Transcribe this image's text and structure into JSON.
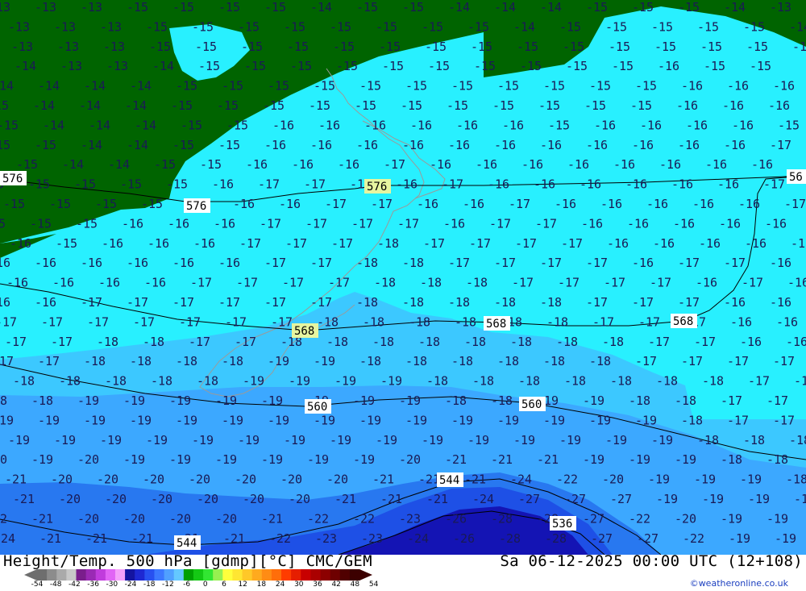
{
  "title": {
    "left": "Height/Temp. 500 hPa [gdmp][°C] CMC/GEM",
    "right": "Sa 06-12-2025 00:00 UTC (12+108)"
  },
  "credit": "©weatheronline.co.uk",
  "legend": {
    "ticks": [
      "-54",
      "-48",
      "-42",
      "-36",
      "-30",
      "-24",
      "-18",
      "-12",
      "-6",
      "0",
      "6",
      "12",
      "18",
      "24",
      "30",
      "36",
      "42",
      "48",
      "54"
    ],
    "colors": [
      "#6e6e6e",
      "#8c8c8c",
      "#aaaaaa",
      "#c8c8c8",
      "#7a1e8c",
      "#9a2ab4",
      "#c03cdc",
      "#e164f5",
      "#f5a0fa",
      "#1414a0",
      "#1e28d2",
      "#2850f0",
      "#3c78ff",
      "#50a0ff",
      "#64c8ff",
      "#00a000",
      "#14c814",
      "#32e632",
      "#96f050",
      "#ffff3c",
      "#ffe632",
      "#ffc828",
      "#ffaa1e",
      "#ff8c14",
      "#ff6e0a",
      "#ff3c00",
      "#e61e00",
      "#c80000",
      "#aa0000",
      "#8c0000",
      "#6e0000",
      "#500000",
      "#3c0000"
    ]
  },
  "map": {
    "colors": {
      "green": "#006400",
      "t15": "#28f0ff",
      "t18": "#3cc8ff",
      "t19": "#3ca8ff",
      "t22": "#2878f0",
      "t25": "#1e50e6",
      "t27": "#1414b4"
    },
    "height_labels": [
      {
        "text": "576"
      },
      {
        "text": "576"
      },
      {
        "text": "576"
      },
      {
        "text": "56"
      },
      {
        "text": "568"
      },
      {
        "text": "568"
      },
      {
        "text": "568"
      },
      {
        "text": "560"
      },
      {
        "text": "560"
      },
      {
        "text": "544"
      },
      {
        "text": "544"
      },
      {
        "text": "536"
      }
    ],
    "temp_rows": [
      {
        "start": -14,
        "values": [
          "-13",
          "-13",
          "-13",
          "-15",
          "-15",
          "-15",
          "-15",
          "-14",
          "-15",
          "-15",
          "-14",
          "-14",
          "-14",
          "-15",
          "-15",
          "-15",
          "-14",
          "-13"
        ]
      },
      {
        "start": 10,
        "values": [
          "-13",
          "-13",
          "-13",
          "-15",
          "-15",
          "-15",
          "-15",
          "-15",
          "-15",
          "-15",
          "-15",
          "-14",
          "-15",
          "-15",
          "-15",
          "-15",
          "-15",
          "-14"
        ]
      },
      {
        "start": 14,
        "values": [
          "-13",
          "-13",
          "-13",
          "-15",
          "-15",
          "-15",
          "-15",
          "-15",
          "-15",
          "-15",
          "-15",
          "-15",
          "-15",
          "-15",
          "-15",
          "-15",
          "-15",
          "-14"
        ]
      },
      {
        "start": 18,
        "values": [
          "-14",
          "-13",
          "-13",
          "-14",
          "-15",
          "-15",
          "-15",
          "-15",
          "-15",
          "-15",
          "-15",
          "-15",
          "-15",
          "-15",
          "-16",
          "-15",
          "-15"
        ]
      },
      {
        "start": -10,
        "values": [
          "-14",
          "-14",
          "-14",
          "-14",
          "-15",
          "-15",
          "-15",
          "-15",
          "-15",
          "-15",
          "-15",
          "-15",
          "-15",
          "-15",
          "-15",
          "-16",
          "-16",
          "-16"
        ]
      },
      {
        "start": -16,
        "values": [
          "-15",
          "-14",
          "-14",
          "-14",
          "-15",
          "-15",
          "-15",
          "-15",
          "-15",
          "-15",
          "-15",
          "-15",
          "-15",
          "-15",
          "-15",
          "-16",
          "-16",
          "-16"
        ]
      },
      {
        "start": -4,
        "values": [
          "-15",
          "-14",
          "-14",
          "-14",
          "-15",
          "-15",
          "-16",
          "-16",
          "-16",
          "-16",
          "-16",
          "-16",
          "-15",
          "-16",
          "-16",
          "-16",
          "-16",
          "-15"
        ]
      },
      {
        "start": -14,
        "values": [
          "-15",
          "-15",
          "-14",
          "-14",
          "-15",
          "-15",
          "-16",
          "-16",
          "-16",
          "-16",
          "-16",
          "-16",
          "-16",
          "-16",
          "-16",
          "-16",
          "-16",
          "-17"
        ]
      },
      {
        "start": 20,
        "values": [
          "-15",
          "-14",
          "-14",
          "-15",
          "-15",
          "-16",
          "-16",
          "-16",
          "-17",
          "-16",
          "-16",
          "-16",
          "-16",
          "-16",
          "-16",
          "-16",
          "-16",
          "-17"
        ]
      },
      {
        "start": -22,
        "values": [
          "-15",
          "-15",
          "-15",
          "-15",
          "-15",
          "-16",
          "-17",
          "-17",
          "-17",
          "-16",
          "-17",
          "-16",
          "-16",
          "-16",
          "-16",
          "-16",
          "-16",
          "-17"
        ]
      },
      {
        "start": 4,
        "values": [
          "-15",
          "-15",
          "-15",
          "-15",
          "-16",
          "-16",
          "-16",
          "-17",
          "-17",
          "-16",
          "-16",
          "-17",
          "-16",
          "-16",
          "-16",
          "-16",
          "-16",
          "-17"
        ]
      },
      {
        "start": -20,
        "values": [
          "-15",
          "-15",
          "-15",
          "-16",
          "-16",
          "-16",
          "-17",
          "-17",
          "-17",
          "-17",
          "-16",
          "-17",
          "-17",
          "-16",
          "-16",
          "-16",
          "-16",
          "-16"
        ]
      },
      {
        "start": 12,
        "values": [
          "-16",
          "-15",
          "-16",
          "-16",
          "-16",
          "-17",
          "-17",
          "-17",
          "-18",
          "-17",
          "-17",
          "-17",
          "-17",
          "-16",
          "-16",
          "-16",
          "-16",
          "-16"
        ]
      },
      {
        "start": -14,
        "values": [
          "-16",
          "-16",
          "-16",
          "-16",
          "-16",
          "-16",
          "-17",
          "-17",
          "-18",
          "-18",
          "-17",
          "-17",
          "-17",
          "-17",
          "-16",
          "-17",
          "-17",
          "-16"
        ]
      },
      {
        "start": 8,
        "values": [
          "-16",
          "-16",
          "-16",
          "-16",
          "-17",
          "-17",
          "-17",
          "-17",
          "-18",
          "-18",
          "-18",
          "-17",
          "-17",
          "-17",
          "-17",
          "-16",
          "-17",
          "-16"
        ]
      },
      {
        "start": -14,
        "values": [
          "-16",
          "-16",
          "-17",
          "-17",
          "-17",
          "-17",
          "-17",
          "-17",
          "-18",
          "-18",
          "-18",
          "-18",
          "-18",
          "-17",
          "-17",
          "-17",
          "-16",
          "-16"
        ]
      },
      {
        "start": -6,
        "values": [
          "-17",
          "-17",
          "-17",
          "-17",
          "-17",
          "-17",
          "-17",
          "-18",
          "-18",
          "-18",
          "-18",
          "-18",
          "-18",
          "-17",
          "-17",
          "-17",
          "-16",
          "-16"
        ]
      },
      {
        "start": 6,
        "values": [
          "-17",
          "-17",
          "-18",
          "-18",
          "-17",
          "-17",
          "-18",
          "-18",
          "-18",
          "-18",
          "-18",
          "-18",
          "-18",
          "-18",
          "-17",
          "-17",
          "-16",
          "-16"
        ]
      },
      {
        "start": -10,
        "values": [
          "-17",
          "-17",
          "-18",
          "-18",
          "-18",
          "-18",
          "-19",
          "-19",
          "-18",
          "-18",
          "-18",
          "-18",
          "-18",
          "-18",
          "-17",
          "-17",
          "-17",
          "-17"
        ]
      },
      {
        "start": 16,
        "values": [
          "-18",
          "-18",
          "-18",
          "-18",
          "-18",
          "-19",
          "-19",
          "-19",
          "-19",
          "-18",
          "-18",
          "-18",
          "-18",
          "-18",
          "-18",
          "-18",
          "-17",
          "-17"
        ]
      },
      {
        "start": -18,
        "values": [
          "-18",
          "-18",
          "-19",
          "-19",
          "-19",
          "-19",
          "-19",
          "-19",
          "-19",
          "-19",
          "-18",
          "-18",
          "-19",
          "-19",
          "-18",
          "-18",
          "-17",
          "-17"
        ]
      },
      {
        "start": -10,
        "values": [
          "-19",
          "-19",
          "-19",
          "-19",
          "-19",
          "-19",
          "-19",
          "-19",
          "-19",
          "-19",
          "-19",
          "-19",
          "-19",
          "-19",
          "-19",
          "-18",
          "-17",
          "-17"
        ]
      },
      {
        "start": 10,
        "values": [
          "-19",
          "-19",
          "-19",
          "-19",
          "-19",
          "-19",
          "-19",
          "-19",
          "-19",
          "-19",
          "-19",
          "-19",
          "-19",
          "-19",
          "-19",
          "-18",
          "-18",
          "-18"
        ]
      },
      {
        "start": -18,
        "values": [
          "-20",
          "-19",
          "-20",
          "-19",
          "-19",
          "-19",
          "-19",
          "-19",
          "-19",
          "-20",
          "-21",
          "-21",
          "-21",
          "-19",
          "-19",
          "-19",
          "-18",
          "-18"
        ]
      },
      {
        "start": 6,
        "values": [
          "-21",
          "-20",
          "-20",
          "-20",
          "-20",
          "-20",
          "-20",
          "-20",
          "-21",
          "-21",
          "-21",
          "-24",
          "-22",
          "-20",
          "-19",
          "-19",
          "-19",
          "-18"
        ]
      },
      {
        "start": 16,
        "values": [
          "-21",
          "-20",
          "-20",
          "-20",
          "-20",
          "-20",
          "-20",
          "-21",
          "-21",
          "-21",
          "-24",
          "-27",
          "-27",
          "-27",
          "-19",
          "-19",
          "-19",
          "-18"
        ]
      },
      {
        "start": -18,
        "values": [
          "-22",
          "-21",
          "-20",
          "-20",
          "-20",
          "-20",
          "-21",
          "-22",
          "-22",
          "-23",
          "-26",
          "-28",
          "-28",
          "-27",
          "-22",
          "-20",
          "-19",
          "-19"
        ]
      },
      {
        "start": -8,
        "values": [
          "-24",
          "-21",
          "-21",
          "-21",
          "-21",
          "-21",
          "-22",
          "-23",
          "-23",
          "-24",
          "-26",
          "-28",
          "-28",
          "-27",
          "-27",
          "-22",
          "-19",
          "-19"
        ]
      }
    ]
  }
}
